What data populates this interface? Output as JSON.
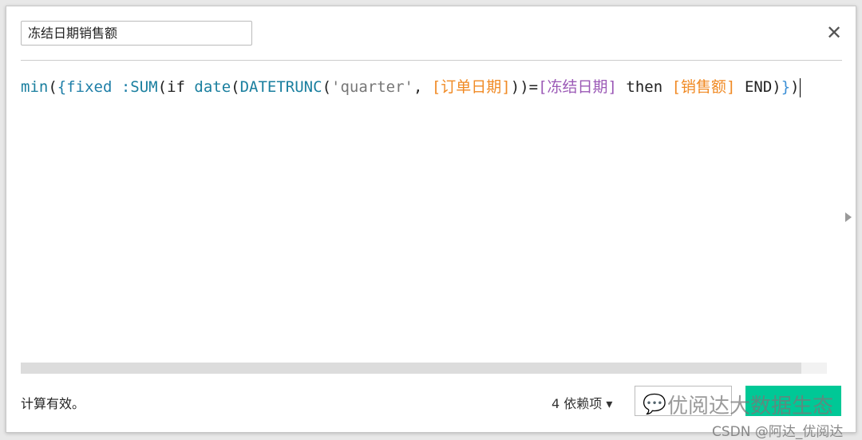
{
  "calc_name": "冻结日期销售额",
  "formula": [
    {
      "t": "min",
      "c": "fn"
    },
    {
      "t": "(",
      "c": ""
    },
    {
      "t": "{fixed :",
      "c": "kw"
    },
    {
      "t": "SUM",
      "c": "fn"
    },
    {
      "t": "(if ",
      "c": ""
    },
    {
      "t": "date",
      "c": "fn"
    },
    {
      "t": "(",
      "c": ""
    },
    {
      "t": "DATETRUNC",
      "c": "fn"
    },
    {
      "t": "(",
      "c": ""
    },
    {
      "t": "'quarter'",
      "c": "str"
    },
    {
      "t": ", ",
      "c": ""
    },
    {
      "t": "[订单日期]",
      "c": "fld"
    },
    {
      "t": "))=",
      "c": ""
    },
    {
      "t": "[冻结日期]",
      "c": "par"
    },
    {
      "t": " then ",
      "c": ""
    },
    {
      "t": "[销售额]",
      "c": "fld"
    },
    {
      "t": " END)",
      "c": ""
    },
    {
      "t": "}",
      "c": "br"
    },
    {
      "t": ")",
      "c": ""
    }
  ],
  "status": "计算有效。",
  "dependencies": "4 依赖项 ▾",
  "watermark": {
    "brand": "优阅达大数据生态",
    "csdn": "CSDN @阿达_优阅达"
  },
  "colors": {
    "accent": "#00c896",
    "field": "#f08a24",
    "parameter": "#9b59b6",
    "function": "#1a7f9f"
  }
}
